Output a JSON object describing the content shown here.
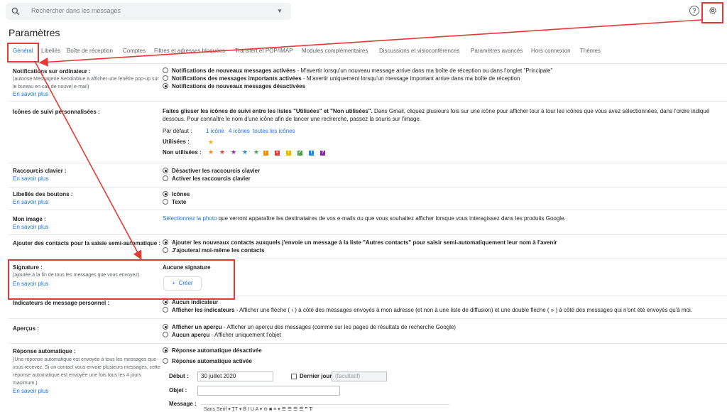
{
  "search": {
    "placeholder": "Rechercher dans les messages"
  },
  "icons": {
    "search": "search-icon",
    "help": "help-icon",
    "gear": "gear-icon",
    "more": "more-vert-icon"
  },
  "colors": {
    "accent": "#1a73e8",
    "annotation": "#e53935"
  },
  "page_title": "Paramètres",
  "tabs": [
    "Général",
    "Libellés",
    "Boîte de réception",
    "Comptes",
    "Filtres et adresses bloquées",
    "Transfert et POP/IMAP",
    "Modules complémentaires",
    "Discussions et visioconférences",
    "Paramètres avancés",
    "Hors connexion",
    "Thèmes"
  ],
  "learn_more": "En savoir plus",
  "notifications": {
    "label": "Notifications sur ordinateur :",
    "desc": [
      "(autorise Messagerie Sendinblue à afficher une fenêtre pop-up sur",
      "le bureau en cas de nouvel e-mail)"
    ],
    "opt1_bold": "Notifications de nouveaux messages activées",
    "opt1_rest": " - M'avertir lorsqu'un nouveau message arrive dans ma boîte de réception ou dans l'onglet \"Principale\"",
    "opt2_bold": "Notifications des messages importants activées",
    "opt2_rest": " - M'avertir uniquement lorsqu'un message important arrive dans ma boîte de réception",
    "opt3_bold": "Notifications de nouveaux messages désactivées"
  },
  "icons_suivi": {
    "label": "Icônes de suivi personnalisées :",
    "intro_bold": "Faites glisser les icônes de suivi entre les listes \"Utilisées\" et \"Non utilisées\".",
    "intro_rest": " Dans Gmail, cliquez plusieurs fois sur une icône pour afficher tour à tour les icônes que vous avez sélectionnées, dans l'ordre indiqué",
    "intro_line2": "dessous. Pour connaître le nom d'une icône afin de lancer une recherche, passez la souris sur l'image.",
    "default_label": "Par défaut :",
    "preset1": "1 icône",
    "preset2": "4 icônes",
    "preset3": "toutes les icônes",
    "used_label": "Utilisées :",
    "unused_label": "Non utilisées :",
    "unused_symbols": [
      "!",
      "»",
      "!",
      "✔",
      "i",
      "?"
    ]
  },
  "shortcuts": {
    "label": "Raccourcis clavier :",
    "opt1": "Désactiver les raccourcis clavier",
    "opt2": "Activer les raccourcis clavier"
  },
  "button_labels": {
    "label": "Libellés des boutons :",
    "opt1": "Icônes",
    "opt2": "Texte"
  },
  "my_image": {
    "label": "Mon image :",
    "link": "Sélectionnez la photo",
    "rest": " que verront apparaître les destinataires de vos e-mails ou que vous souhaitez afficher lorsque vous interagissez dans les produits Google."
  },
  "contacts": {
    "label": "Ajouter des contacts pour la saisie semi-automatique :",
    "opt1": "Ajouter les nouveaux contacts auxquels j'envoie un message à la liste \"Autres contacts\" pour saisir semi-automatiquement leur nom à l'avenir",
    "opt2": "J'ajouterai moi-même les contacts"
  },
  "signature": {
    "label": "Signature :",
    "desc": "(ajoutée à la fin de tous les messages que vous envoyez)",
    "none": "Aucune signature",
    "create": "Créer"
  },
  "indicators": {
    "label": "Indicateurs de message personnel :",
    "opt1": "Aucun indicateur",
    "opt2_bold": "Afficher les indicateurs",
    "opt2_rest": " - Afficher une flèche ( › ) à côté des messages envoyés à mon adresse (et non à une liste de diffusion) et une double flèche ( » ) à côté des messages qui n'ont été envoyés qu'à moi."
  },
  "previews": {
    "label": "Aperçus :",
    "opt1_bold": "Afficher un aperçu",
    "opt1_rest": " - Afficher un aperçu des messages (comme sur les pages de résultats de recherche Google)",
    "opt2_bold": "Aucun aperçu",
    "opt2_rest": " - Afficher uniquement l'objet"
  },
  "auto_reply": {
    "label": "Réponse automatique :",
    "desc": [
      "(Une réponse automatique est envoyée à tous les messages que",
      "vous recevez. Si un contact vous envoie plusieurs messages, cette",
      "réponse automatique est envoyée une fois tous les 4 jours",
      "maximum.)"
    ],
    "opt1": "Réponse automatique désactivée",
    "opt2": "Réponse automatique activée",
    "start_label": "Début :",
    "start_value": "30 juillet 2020",
    "end_label": "Dernier jour :",
    "end_placeholder": "(facultatif)",
    "subject_label": "Objet :",
    "message_label": "Message :",
    "toolbar": "Sans Serif  ▾   T̲T ▾   B   I   U   A ▾   ⊖   ■   ≡ ▾   ☰   ☰   ☰   ☰   ❞   T̸"
  }
}
